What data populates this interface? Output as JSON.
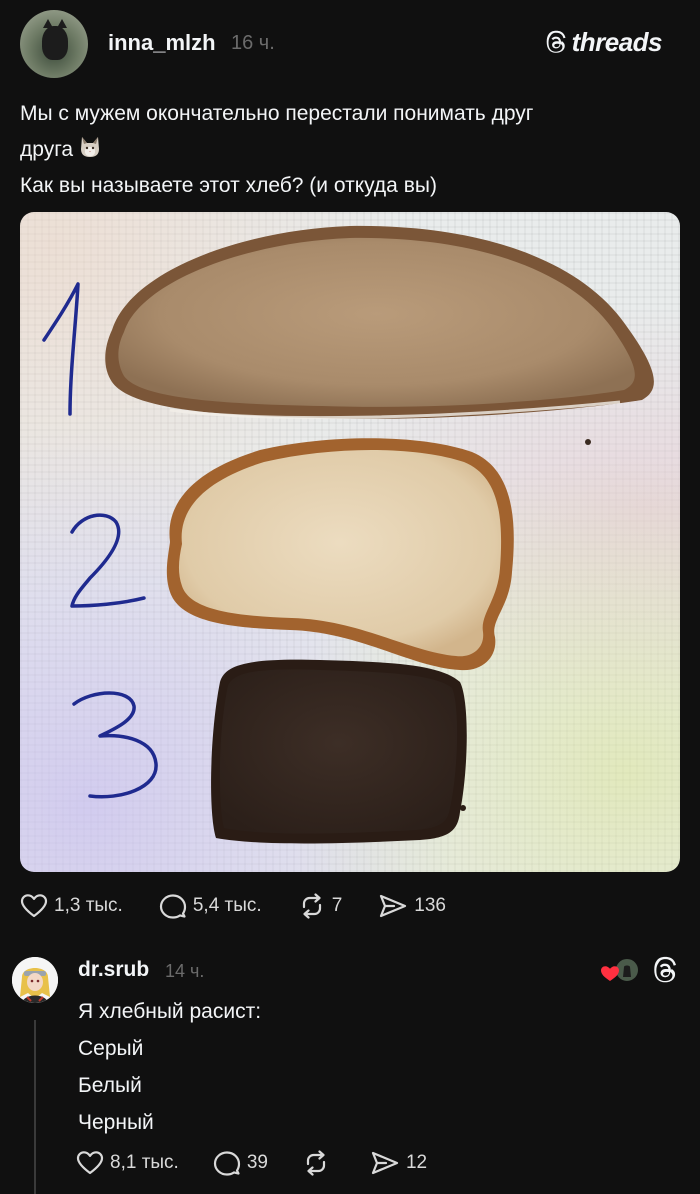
{
  "post": {
    "author": "inna_mlzh",
    "time": "16 ч.",
    "brand": "threads",
    "text_lines": [
      "Мы с мужем окончательно перестали понимать друг",
      "друга",
      "Как вы называете этот хлеб? (и откуда вы)"
    ],
    "photo": {
      "numbers": [
        "1",
        "2",
        "3"
      ]
    },
    "stats": {
      "likes": "1,3 тыс.",
      "replies": "5,4 тыс.",
      "reposts": "7",
      "shares": "136"
    }
  },
  "reply": {
    "author": "dr.srub",
    "time": "14 ч.",
    "lines": [
      "Я хлебный расист:",
      "Серый",
      "Белый",
      "Черный"
    ],
    "stats": {
      "likes": "8,1 тыс.",
      "replies": "39",
      "reposts": "",
      "shares": "12"
    }
  },
  "colors": {
    "background": "#101010",
    "text": "#f3f5f7",
    "muted": "#6b6b6b",
    "heart": "#ff3040"
  }
}
